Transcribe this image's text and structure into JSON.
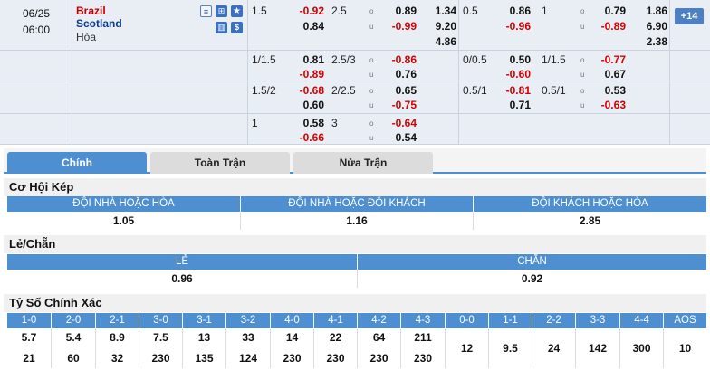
{
  "match": {
    "date": "06/25",
    "time": "06:00",
    "home": "Brazil",
    "away": "Scotland",
    "draw_label": "Hòa",
    "more_count": "+14",
    "icons": [
      "document-icon",
      "grid-icon",
      "star-icon",
      "bar-chart-icon",
      "dollar-icon"
    ]
  },
  "odds_rows": [
    {
      "ah_ft_line": "1.5",
      "ah_ft_home": "-0.92",
      "ah_ft_away": "0.84",
      "ou_ft_line": "2.5",
      "ou_ft_over": "0.89",
      "ou_ft_under": "-0.99",
      "x12_ft": [
        "1.34",
        "9.20",
        "4.86"
      ],
      "ah_h1_line": "0.5",
      "ah_h1_home": "0.86",
      "ah_h1_away": "-0.96",
      "ou_h1_line": "1",
      "ou_h1_over": "0.79",
      "ou_h1_under": "-0.89",
      "x12_h1": [
        "1.86",
        "6.90",
        "2.38"
      ]
    },
    {
      "ah_ft_line": "1/1.5",
      "ah_ft_home": "0.81",
      "ah_ft_away": "-0.89",
      "ou_ft_line": "2.5/3",
      "ou_ft_over": "-0.86",
      "ou_ft_under": "0.76",
      "ah_h1_line": "0/0.5",
      "ah_h1_home": "0.50",
      "ah_h1_away": "-0.60",
      "ou_h1_line": "1/1.5",
      "ou_h1_over": "-0.77",
      "ou_h1_under": "0.67"
    },
    {
      "ah_ft_line": "1.5/2",
      "ah_ft_home": "-0.68",
      "ah_ft_away": "0.60",
      "ou_ft_line": "2/2.5",
      "ou_ft_over": "0.65",
      "ou_ft_under": "-0.75",
      "ah_h1_line": "0.5/1",
      "ah_h1_home": "-0.81",
      "ah_h1_away": "0.71",
      "ou_h1_line": "0.5/1",
      "ou_h1_over": "0.53",
      "ou_h1_under": "-0.63"
    },
    {
      "ah_ft_line": "1",
      "ah_ft_home": "0.58",
      "ah_ft_away": "-0.66",
      "ou_ft_line": "3",
      "ou_ft_over": "-0.64",
      "ou_ft_under": "0.54"
    }
  ],
  "ou_marks": {
    "over": "o",
    "under": "u"
  },
  "tabs": [
    "Chính",
    "Toàn Trận",
    "Nửa Trận"
  ],
  "double_chance": {
    "title": "Cơ Hội Kép",
    "headers": [
      "ĐỘI NHÀ HOẶC HÒA",
      "ĐỘI NHÀ HOẶC ĐỘI KHÁCH",
      "ĐỘI KHÁCH HOẶC HÒA"
    ],
    "values": [
      "1.05",
      "1.16",
      "2.85"
    ]
  },
  "odd_even": {
    "title": "Lẻ/Chẵn",
    "headers": [
      "LẺ",
      "CHẴN"
    ],
    "values": [
      "0.96",
      "0.92"
    ]
  },
  "correct_score": {
    "title": "Tỷ Số Chính Xác",
    "headers": [
      "1-0",
      "2-0",
      "2-1",
      "3-0",
      "3-1",
      "3-2",
      "4-0",
      "4-1",
      "4-2",
      "4-3",
      "0-0",
      "1-1",
      "2-2",
      "3-3",
      "4-4",
      "AOS"
    ],
    "home_values": [
      "5.7",
      "5.4",
      "8.9",
      "7.5",
      "13",
      "33",
      "14",
      "22",
      "64",
      "211"
    ],
    "away_values": [
      "21",
      "60",
      "32",
      "230",
      "135",
      "124",
      "230",
      "230",
      "230",
      "230"
    ],
    "draw_values": [
      "12",
      "9.5",
      "24",
      "142",
      "300",
      "10"
    ]
  }
}
